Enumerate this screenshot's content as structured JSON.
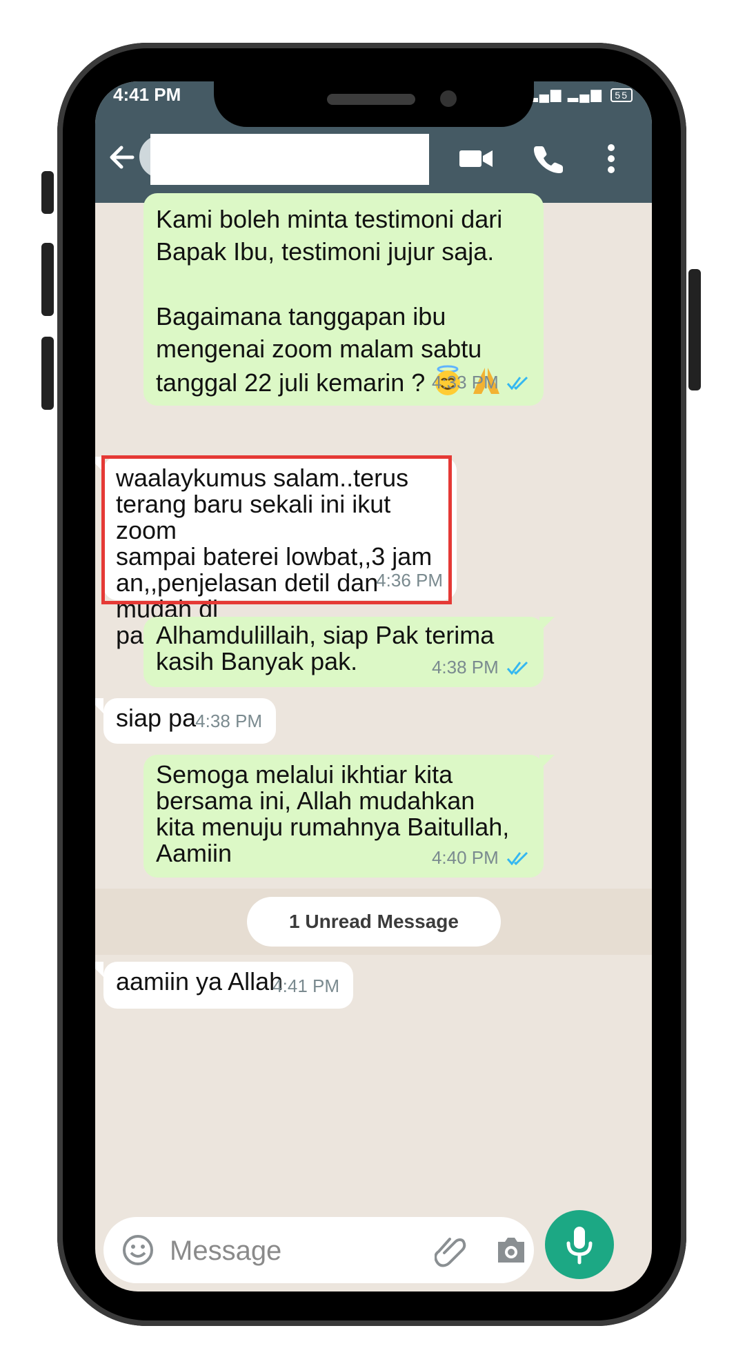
{
  "status_bar": {
    "time": "4:41 PM",
    "battery": "55"
  },
  "app_bar": {
    "icons": [
      "back-arrow-icon",
      "video-call-icon",
      "phone-icon",
      "more-vert-icon"
    ]
  },
  "messages": [
    {
      "direction": "outgoing",
      "text": "Kami boleh minta testimoni dari\nBapak Ibu, testimoni jujur saja.\n\nBagaimana tanggapan ibu\nmengenai zoom malam sabtu\ntanggal 22 juli kemarin ?",
      "emoji": [
        "smiling-halo-emoji",
        "folded-hands-emoji"
      ],
      "time": "4:33 PM",
      "status": "read"
    },
    {
      "direction": "incoming",
      "text": "waalaykumus salam..terus\nterang baru sekali ini ikut zoom\nsampai baterei lowbat,,3 jam\nan,,penjelasan detil dan mudah di\npahami",
      "time": "4:36 PM",
      "highlighted": true
    },
    {
      "direction": "outgoing",
      "text": "Alhamdulillaih, siap Pak terima\nkasih Banyak pak.",
      "time": "4:38 PM",
      "status": "read"
    },
    {
      "direction": "incoming",
      "text": "siap pa",
      "time": "4:38 PM"
    },
    {
      "direction": "outgoing",
      "text": "Semoga melalui ikhtiar kita\nbersama ini, Allah mudahkan\nkita menuju rumahnya Baitullah,\nAamiin",
      "time": "4:40 PM",
      "status": "read"
    },
    {
      "direction": "incoming",
      "text": "aamiin ya Allah",
      "time": "4:41 PM"
    }
  ],
  "unread_divider": "1 Unread Message",
  "composer": {
    "placeholder": "Message"
  },
  "colors": {
    "header": "#455a64",
    "outgoing_bubble": "#dcf8c6",
    "incoming_bubble": "#ffffff",
    "highlight_border": "#e53935",
    "mic_button": "#1ca884",
    "read_ticks": "#34b7f1"
  },
  "nav_bar": {
    "icons": [
      "recent-apps-icon",
      "home-icon",
      "back-icon"
    ]
  }
}
